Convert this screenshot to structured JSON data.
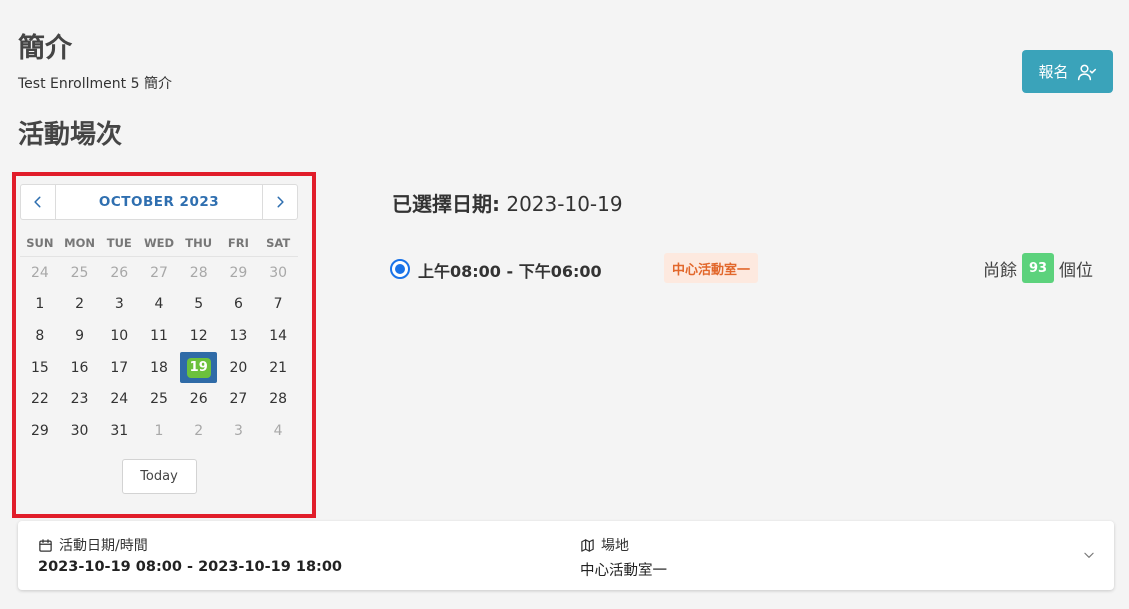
{
  "header": {
    "title": "簡介",
    "subtitle": "Test Enrollment 5 簡介",
    "enroll_label": "報名"
  },
  "section": {
    "title": "活動場次"
  },
  "calendar": {
    "month_label": "OCTOBER 2023",
    "weekdays": [
      "SUN",
      "MON",
      "TUE",
      "WED",
      "THU",
      "FRI",
      "SAT"
    ],
    "days": [
      {
        "d": "24",
        "muted": true
      },
      {
        "d": "25",
        "muted": true
      },
      {
        "d": "26",
        "muted": true
      },
      {
        "d": "27",
        "muted": true
      },
      {
        "d": "28",
        "muted": true
      },
      {
        "d": "29",
        "muted": true
      },
      {
        "d": "30",
        "muted": true
      },
      {
        "d": "1"
      },
      {
        "d": "2"
      },
      {
        "d": "3"
      },
      {
        "d": "4"
      },
      {
        "d": "5"
      },
      {
        "d": "6"
      },
      {
        "d": "7"
      },
      {
        "d": "8"
      },
      {
        "d": "9"
      },
      {
        "d": "10"
      },
      {
        "d": "11"
      },
      {
        "d": "12"
      },
      {
        "d": "13"
      },
      {
        "d": "14"
      },
      {
        "d": "15"
      },
      {
        "d": "16"
      },
      {
        "d": "17"
      },
      {
        "d": "18"
      },
      {
        "d": "19",
        "selected": true
      },
      {
        "d": "20"
      },
      {
        "d": "21"
      },
      {
        "d": "22"
      },
      {
        "d": "23"
      },
      {
        "d": "24"
      },
      {
        "d": "25"
      },
      {
        "d": "26"
      },
      {
        "d": "27"
      },
      {
        "d": "28"
      },
      {
        "d": "29"
      },
      {
        "d": "30"
      },
      {
        "d": "31"
      },
      {
        "d": "1",
        "muted": true
      },
      {
        "d": "2",
        "muted": true
      },
      {
        "d": "3",
        "muted": true
      },
      {
        "d": "4",
        "muted": true
      }
    ],
    "today_label": "Today"
  },
  "selected": {
    "label": "已選擇日期:",
    "date": "2023-10-19"
  },
  "session": {
    "time": "上午08:00 - 下午06:00",
    "venue": "中心活動室一",
    "remain_prefix": "尚餘",
    "remain_count": "93",
    "remain_suffix": "個位"
  },
  "info": {
    "datetime_label": "活動日期/時間",
    "datetime_value": "2023-10-19 08:00 - 2023-10-19 18:00",
    "venue_label": "場地",
    "venue_value": "中心活動室一"
  },
  "colors": {
    "accent": "#3aa3ba",
    "calendar_blue": "#2f6fb0",
    "selected_chip": "#6cc13c",
    "highlight_outline": "#e11d2a",
    "remain_badge": "#5cd27c",
    "venue_tag_text": "#e2672b"
  },
  "icons": {
    "enroll": "user-check-icon",
    "prev": "chevron-left-icon",
    "next": "chevron-right-icon",
    "datetime": "calendar-icon",
    "venue": "map-icon",
    "expand": "chevron-down-icon"
  }
}
